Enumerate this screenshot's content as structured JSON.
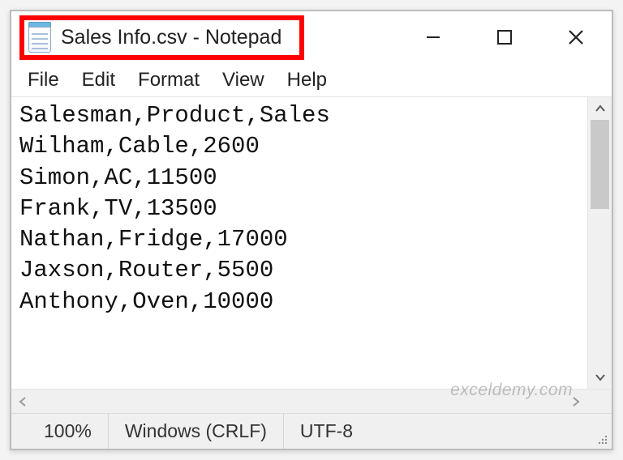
{
  "window": {
    "title": "Sales Info.csv - Notepad",
    "controls": {
      "minimize": "minimize",
      "maximize": "maximize",
      "close": "close"
    }
  },
  "menu": {
    "file": "File",
    "edit": "Edit",
    "format": "Format",
    "view": "View",
    "help": "Help"
  },
  "content": {
    "lines": [
      "Salesman,Product,Sales",
      "Wilham,Cable,2600",
      "Simon,AC,11500",
      "Frank,TV,13500",
      "Nathan,Fridge,17000",
      "Jaxson,Router,5500",
      "Anthony,Oven,10000"
    ],
    "text": "Salesman,Product,Sales\nWilham,Cable,2600\nSimon,AC,11500\nFrank,TV,13500\nNathan,Fridge,17000\nJaxson,Router,5500\nAnthony,Oven,10000"
  },
  "statusbar": {
    "zoom": "100%",
    "line_ending": "Windows (CRLF)",
    "encoding": "UTF-8"
  },
  "watermark": "exceldemy.com"
}
